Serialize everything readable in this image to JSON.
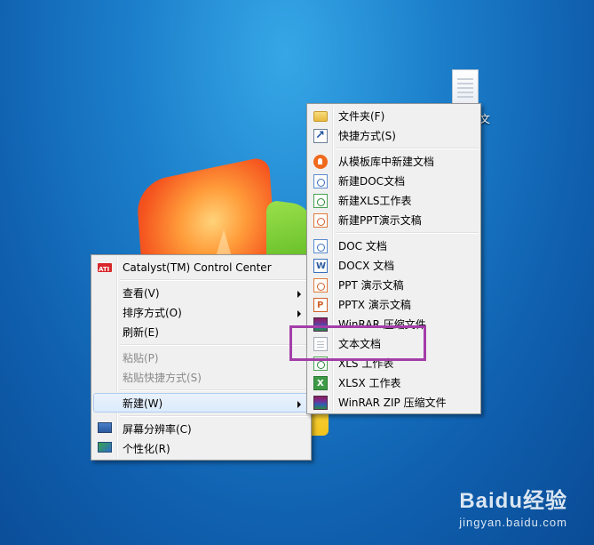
{
  "desktop": {
    "file_label": "文"
  },
  "main_menu": {
    "items": [
      {
        "label": "Catalyst(TM) Control Center",
        "icon": "ati-icon",
        "submenu": false,
        "disabled": false
      },
      {
        "label": "查看(V)",
        "submenu": true,
        "disabled": false
      },
      {
        "label": "排序方式(O)",
        "submenu": true,
        "disabled": false
      },
      {
        "label": "刷新(E)",
        "submenu": false,
        "disabled": false
      },
      {
        "label": "粘贴(P)",
        "submenu": false,
        "disabled": true
      },
      {
        "label": "粘贴快捷方式(S)",
        "submenu": false,
        "disabled": true
      },
      {
        "label": "新建(W)",
        "submenu": true,
        "disabled": false,
        "hover": true
      },
      {
        "label": "屏幕分辨率(C)",
        "icon": "display-icon",
        "submenu": false,
        "disabled": false
      },
      {
        "label": "个性化(R)",
        "icon": "personalize-icon",
        "submenu": false,
        "disabled": false
      }
    ]
  },
  "new_submenu": {
    "items": [
      {
        "label": "文件夹(F)",
        "icon": "folder-icon"
      },
      {
        "label": "快捷方式(S)",
        "icon": "shortcut-icon"
      },
      {
        "label": "从模板库中新建文档",
        "icon": "template-icon"
      },
      {
        "label": "新建DOC文档",
        "icon": "doc-icon"
      },
      {
        "label": "新建XLS工作表",
        "icon": "xls-icon"
      },
      {
        "label": "新建PPT演示文稿",
        "icon": "ppt-icon"
      },
      {
        "label": "DOC 文档",
        "icon": "doc-icon"
      },
      {
        "label": "DOCX 文档",
        "icon": "docx-icon"
      },
      {
        "label": "PPT 演示文稿",
        "icon": "ppt-icon"
      },
      {
        "label": "PPTX 演示文稿",
        "icon": "pptx-icon"
      },
      {
        "label": "WinRAR 压缩文件",
        "icon": "winrar-icon"
      },
      {
        "label": "文本文档",
        "icon": "text-file-icon",
        "highlighted": true
      },
      {
        "label": "XLS 工作表",
        "icon": "xls-icon"
      },
      {
        "label": "XLSX 工作表",
        "icon": "xlsx-icon"
      },
      {
        "label": "WinRAR ZIP 压缩文件",
        "icon": "winrar-icon"
      }
    ]
  },
  "highlight_color": "#a33ea8",
  "watermark": {
    "logo": "Baidu经验",
    "url": "jingyan.baidu.com"
  }
}
